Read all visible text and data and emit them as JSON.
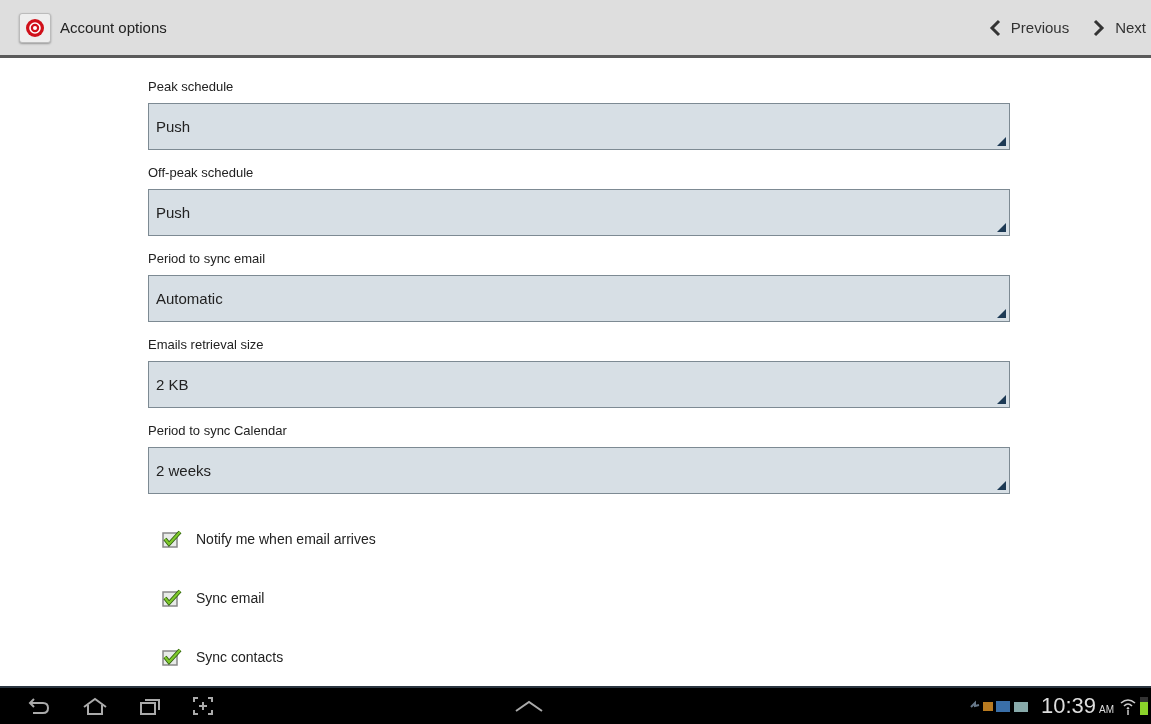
{
  "header": {
    "title": "Account options",
    "previous": "Previous",
    "next": "Next"
  },
  "fields": [
    {
      "label": "Peak schedule",
      "value": "Push"
    },
    {
      "label": "Off-peak schedule",
      "value": "Push"
    },
    {
      "label": "Period to sync email",
      "value": "Automatic"
    },
    {
      "label": "Emails retrieval size",
      "value": "2 KB"
    },
    {
      "label": "Period to sync Calendar",
      "value": "2 weeks"
    }
  ],
  "checkboxes": [
    {
      "label": "Notify me when email arrives",
      "checked": true
    },
    {
      "label": "Sync email",
      "checked": true
    },
    {
      "label": "Sync contacts",
      "checked": true
    }
  ],
  "status_bar": {
    "time": "10:39",
    "ampm": "AM"
  }
}
